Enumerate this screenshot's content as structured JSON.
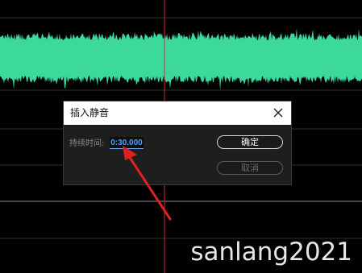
{
  "colors": {
    "waveform": "#3dd99c",
    "background": "#000000",
    "grid": "#1f3a1f",
    "playhead": "#d7263d",
    "arrow": "#e02020",
    "input_text": "#4ea2ff"
  },
  "dialog": {
    "title": "插入静音",
    "close_icon": "close-icon",
    "duration_label": "持续时间:",
    "duration_value": "0:30.000",
    "ok_label": "确定",
    "cancel_label": "取消"
  },
  "watermark": "sanlang2021"
}
